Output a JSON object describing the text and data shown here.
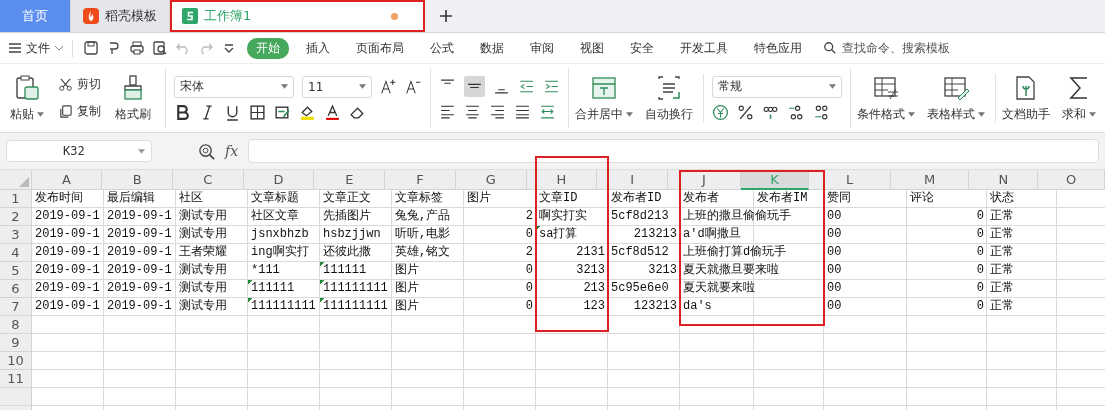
{
  "tabs": [
    {
      "label": "首页",
      "kind": "home",
      "selected": false,
      "unsaved": false,
      "highlighted": false
    },
    {
      "label": "稻壳模板",
      "kind": "docer",
      "selected": false,
      "unsaved": false,
      "highlighted": false
    },
    {
      "label": "工作簿1",
      "kind": "sheet",
      "selected": true,
      "unsaved": true,
      "highlighted": true
    }
  ],
  "menu": {
    "file": "文件",
    "tabs": [
      {
        "label": "开始",
        "selected": true
      },
      {
        "label": "插入",
        "selected": false
      },
      {
        "label": "页面布局",
        "selected": false
      },
      {
        "label": "公式",
        "selected": false
      },
      {
        "label": "数据",
        "selected": false
      },
      {
        "label": "审阅",
        "selected": false
      },
      {
        "label": "视图",
        "selected": false
      },
      {
        "label": "安全",
        "selected": false
      },
      {
        "label": "开发工具",
        "selected": false
      },
      {
        "label": "特色应用",
        "selected": false
      }
    ],
    "search": {
      "placeholder": "查找命令、搜索模板"
    }
  },
  "ribbon": {
    "paste": "粘贴",
    "cut": "剪切",
    "copy": "复制",
    "format_painter": "格式刷",
    "font": "宋体",
    "font_size": "11",
    "merge": "合并居中",
    "wrap": "自动换行",
    "number_format": "常规",
    "conditional": "条件格式",
    "table_style": "表格样式",
    "assistant": "文档助手",
    "sum": "求和"
  },
  "formula_bar": {
    "name_box": "K32",
    "fx": "fx"
  },
  "sheet": {
    "columns": [
      {
        "label": "A",
        "selected": false,
        "framed": false
      },
      {
        "label": "B",
        "selected": false,
        "framed": false
      },
      {
        "label": "C",
        "selected": false,
        "framed": false
      },
      {
        "label": "D",
        "selected": false,
        "framed": false
      },
      {
        "label": "E",
        "selected": false,
        "framed": false
      },
      {
        "label": "F",
        "selected": false,
        "framed": false
      },
      {
        "label": "G",
        "selected": false,
        "framed": false
      },
      {
        "label": "H",
        "selected": false,
        "framed": true
      },
      {
        "label": "I",
        "selected": false,
        "framed": false
      },
      {
        "label": "J",
        "selected": false,
        "framed": true
      },
      {
        "label": "K",
        "selected": true,
        "framed": true
      },
      {
        "label": "L",
        "selected": false,
        "framed": false
      },
      {
        "label": "M",
        "selected": false,
        "framed": false
      },
      {
        "label": "N",
        "selected": false,
        "framed": false
      },
      {
        "label": "O",
        "selected": false,
        "framed": false
      }
    ],
    "rows": [
      {
        "number": "1",
        "cells": [
          {
            "text": "发布时间",
            "number": false,
            "flag": false
          },
          {
            "text": "最后编辑",
            "number": false,
            "flag": false
          },
          {
            "text": "社区",
            "number": false,
            "flag": false
          },
          {
            "text": "文章标题",
            "number": false,
            "flag": false
          },
          {
            "text": "文章正文",
            "number": false,
            "flag": false
          },
          {
            "text": "文章标签",
            "number": false,
            "flag": false
          },
          {
            "text": "图片",
            "number": false,
            "flag": false
          },
          {
            "text": "文章ID",
            "number": false,
            "flag": false
          },
          {
            "text": "发布者ID",
            "number": false,
            "flag": false
          },
          {
            "text": "发布者",
            "number": false,
            "flag": false
          },
          {
            "text": "发布者IM",
            "number": false,
            "flag": false
          },
          {
            "text": "赞同",
            "number": false,
            "flag": false
          },
          {
            "text": "评论",
            "number": false,
            "flag": false
          },
          {
            "text": "状态",
            "number": false,
            "flag": false
          }
        ]
      },
      {
        "number": "2",
        "cells": [
          {
            "text": "2019-09-1",
            "number": false,
            "flag": false
          },
          {
            "text": "2019-09-1",
            "number": false,
            "flag": false
          },
          {
            "text": "测试专用",
            "number": false,
            "flag": false
          },
          {
            "text": "社区文章",
            "number": false,
            "flag": false
          },
          {
            "text": "先插图片",
            "number": false,
            "flag": false
          },
          {
            "text": "兔兔,产品",
            "number": false,
            "flag": false
          },
          {
            "text": "2",
            "number": true,
            "flag": false
          },
          {
            "text": "啊实打实",
            "number": false,
            "flag": false
          },
          {
            "text": "5cf8d213",
            "number": false,
            "flag": false
          },
          {
            "text": "上班的撒旦偷偷玩手",
            "number": false,
            "flag": false
          },
          null,
          {
            "text": "00",
            "number": false,
            "flag": false
          },
          {
            "text": "0",
            "number": true,
            "flag": false
          },
          {
            "text": "正常",
            "number": false,
            "flag": false
          }
        ]
      },
      {
        "number": "3",
        "cells": [
          {
            "text": "2019-09-1",
            "number": false,
            "flag": false
          },
          {
            "text": "2019-09-1",
            "number": false,
            "flag": false
          },
          {
            "text": "测试专用",
            "number": false,
            "flag": false
          },
          {
            "text": "jsnxbhzb",
            "number": false,
            "flag": false
          },
          {
            "text": "hsbzjjwn",
            "number": false,
            "flag": false
          },
          {
            "text": "听听,电影",
            "number": false,
            "flag": false
          },
          {
            "text": "0",
            "number": true,
            "flag": false
          },
          {
            "text": "sa打算",
            "number": false,
            "flag": true
          },
          {
            "text": "213213",
            "number": true,
            "flag": false
          },
          {
            "text": "a'd啊撒旦",
            "number": false,
            "flag": false
          },
          null,
          {
            "text": "00",
            "number": false,
            "flag": false
          },
          {
            "text": "0",
            "number": true,
            "flag": false
          },
          {
            "text": "正常",
            "number": false,
            "flag": false
          }
        ]
      },
      {
        "number": "4",
        "cells": [
          {
            "text": "2019-09-1",
            "number": false,
            "flag": false
          },
          {
            "text": "2019-09-1",
            "number": false,
            "flag": false
          },
          {
            "text": "王者荣耀",
            "number": false,
            "flag": false
          },
          {
            "text": "ing啊实打",
            "number": false,
            "flag": false
          },
          {
            "text": "还彼此撒",
            "number": false,
            "flag": false
          },
          {
            "text": "英雄,铭文",
            "number": false,
            "flag": false
          },
          {
            "text": "2",
            "number": true,
            "flag": false
          },
          {
            "text": "2131",
            "number": true,
            "flag": false
          },
          {
            "text": "5cf8d512",
            "number": false,
            "flag": false
          },
          {
            "text": "上班偷打算d偷玩手",
            "number": false,
            "flag": false
          },
          null,
          {
            "text": "00",
            "number": false,
            "flag": false
          },
          {
            "text": "0",
            "number": true,
            "flag": false
          },
          {
            "text": "正常",
            "number": false,
            "flag": false
          }
        ]
      },
      {
        "number": "5",
        "cells": [
          {
            "text": "2019-09-1",
            "number": false,
            "flag": false
          },
          {
            "text": "2019-09-1",
            "number": false,
            "flag": false
          },
          {
            "text": "测试专用",
            "number": false,
            "flag": false
          },
          {
            "text": "*111",
            "number": false,
            "flag": false
          },
          {
            "text": "111111",
            "number": false,
            "flag": true
          },
          {
            "text": "图片",
            "number": false,
            "flag": false
          },
          {
            "text": "0",
            "number": true,
            "flag": false
          },
          {
            "text": "3213",
            "number": true,
            "flag": false
          },
          {
            "text": "3213",
            "number": true,
            "flag": false
          },
          {
            "text": "夏天就撒旦要来啦",
            "number": false,
            "flag": false
          },
          null,
          {
            "text": "00",
            "number": false,
            "flag": false
          },
          {
            "text": "0",
            "number": true,
            "flag": false
          },
          {
            "text": "正常",
            "number": false,
            "flag": false
          }
        ]
      },
      {
        "number": "6",
        "cells": [
          {
            "text": "2019-09-1",
            "number": false,
            "flag": false
          },
          {
            "text": "2019-09-1",
            "number": false,
            "flag": false
          },
          {
            "text": "测试专用",
            "number": false,
            "flag": false
          },
          {
            "text": "111111",
            "number": false,
            "flag": true
          },
          {
            "text": "111111111",
            "number": false,
            "flag": true
          },
          {
            "text": "图片",
            "number": false,
            "flag": false
          },
          {
            "text": "0",
            "number": true,
            "flag": false
          },
          {
            "text": "213",
            "number": true,
            "flag": false
          },
          {
            "text": "5c95e6e0",
            "number": false,
            "flag": false
          },
          {
            "text": "夏天就要来啦",
            "number": false,
            "flag": false
          },
          null,
          {
            "text": "00",
            "number": false,
            "flag": false
          },
          {
            "text": "0",
            "number": true,
            "flag": false
          },
          {
            "text": "正常",
            "number": false,
            "flag": false
          }
        ]
      },
      {
        "number": "7",
        "cells": [
          {
            "text": "2019-09-1",
            "number": false,
            "flag": false
          },
          {
            "text": "2019-09-1",
            "number": false,
            "flag": false
          },
          {
            "text": "测试专用",
            "number": false,
            "flag": false
          },
          {
            "text": "111111111",
            "number": false,
            "flag": true
          },
          {
            "text": "111111111",
            "number": false,
            "flag": true
          },
          {
            "text": "图片",
            "number": false,
            "flag": false
          },
          {
            "text": "0",
            "number": true,
            "flag": false
          },
          {
            "text": "123",
            "number": true,
            "flag": false
          },
          {
            "text": "123213",
            "number": true,
            "flag": false
          },
          {
            "text": "da's",
            "number": false,
            "flag": false
          },
          null,
          {
            "text": "00",
            "number": false,
            "flag": false
          },
          {
            "text": "0",
            "number": true,
            "flag": false
          },
          {
            "text": "正常",
            "number": false,
            "flag": false
          }
        ]
      }
    ],
    "empty_rows": [
      "8",
      "9",
      "10",
      "11"
    ]
  }
}
